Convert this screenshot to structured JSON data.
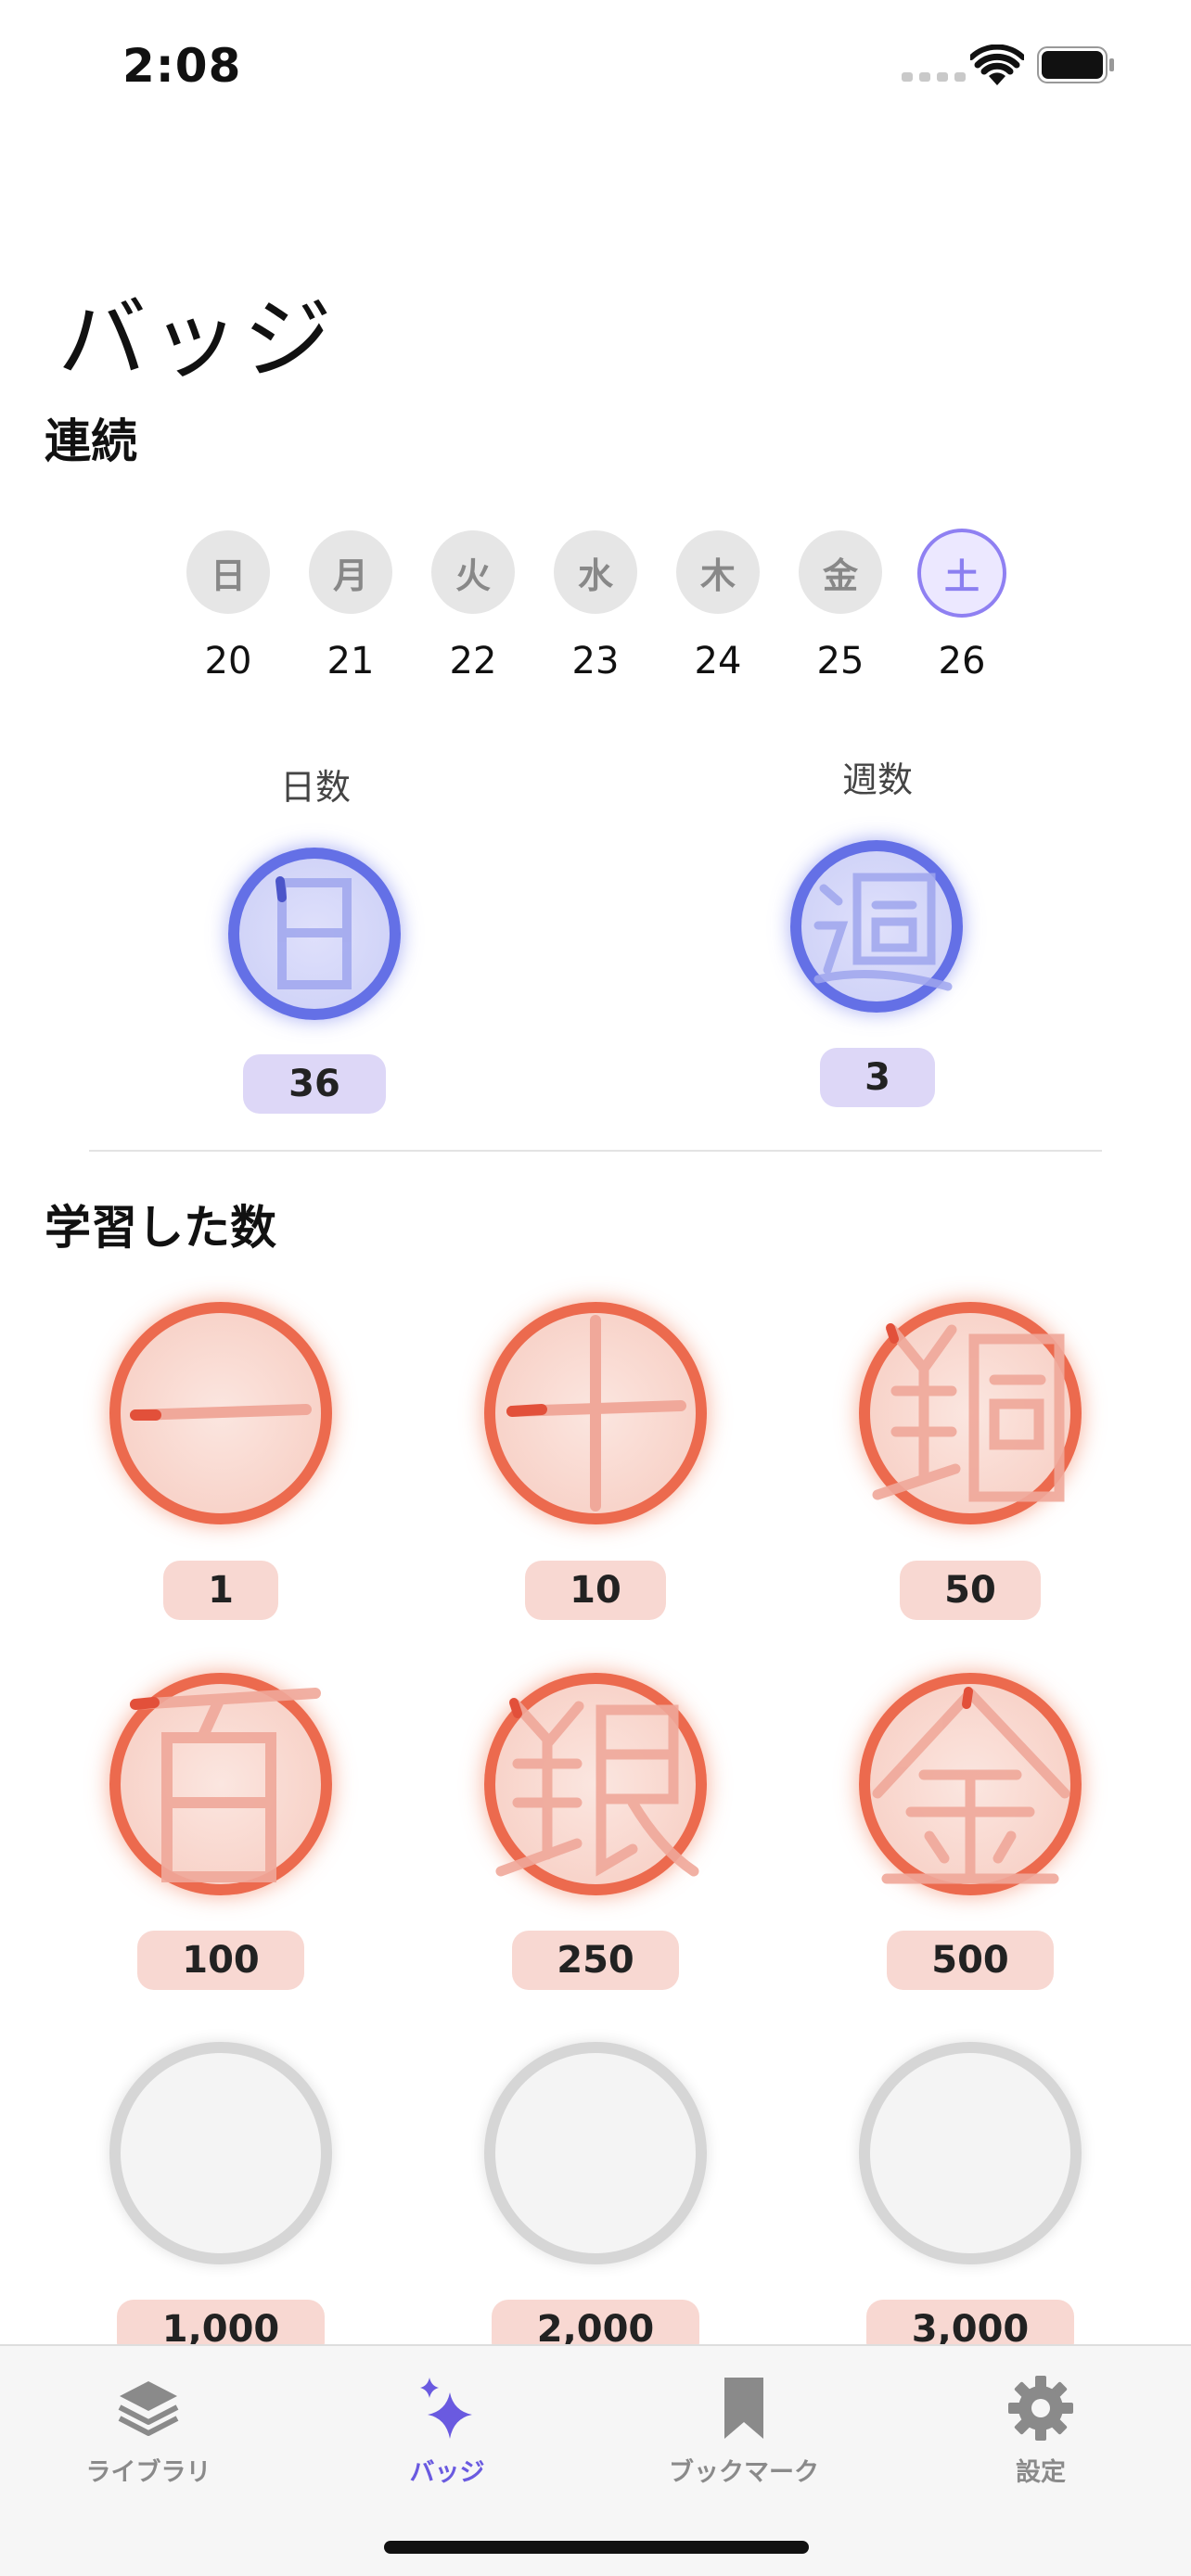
{
  "status_bar": {
    "time": "2:08"
  },
  "page": {
    "title": "バッジ"
  },
  "streak": {
    "section_title": "連続",
    "days": [
      {
        "label": "日",
        "date": "20",
        "today": false
      },
      {
        "label": "月",
        "date": "21",
        "today": false
      },
      {
        "label": "火",
        "date": "22",
        "today": false
      },
      {
        "label": "水",
        "date": "23",
        "today": false
      },
      {
        "label": "木",
        "date": "24",
        "today": false
      },
      {
        "label": "金",
        "date": "25",
        "today": false
      },
      {
        "label": "土",
        "date": "26",
        "today": true
      }
    ],
    "day_count": {
      "label": "日数",
      "value": "36"
    },
    "week_count": {
      "label": "週数",
      "value": "3"
    }
  },
  "learned": {
    "section_title": "学習した数",
    "badges": [
      {
        "value": "1",
        "earned": true
      },
      {
        "value": "10",
        "earned": true
      },
      {
        "value": "50",
        "earned": true
      },
      {
        "value": "100",
        "earned": true
      },
      {
        "value": "250",
        "earned": true
      },
      {
        "value": "500",
        "earned": true
      },
      {
        "value": "1,000",
        "earned": false
      },
      {
        "value": "2,000",
        "earned": false
      },
      {
        "value": "3,000",
        "earned": false
      }
    ]
  },
  "colors": {
    "accent": "#6a5ae0",
    "streak_badge": "#6470e6",
    "earned_badge": "#ec6a4e",
    "locked_badge": "#d6d6d6"
  },
  "tabbar": {
    "tabs": [
      {
        "label": "ライブラリ",
        "icon": "stack-icon",
        "active": false
      },
      {
        "label": "バッジ",
        "icon": "sparkles-icon",
        "active": true
      },
      {
        "label": "ブックマーク",
        "icon": "bookmark-icon",
        "active": false
      },
      {
        "label": "設定",
        "icon": "gear-icon",
        "active": false
      }
    ]
  }
}
